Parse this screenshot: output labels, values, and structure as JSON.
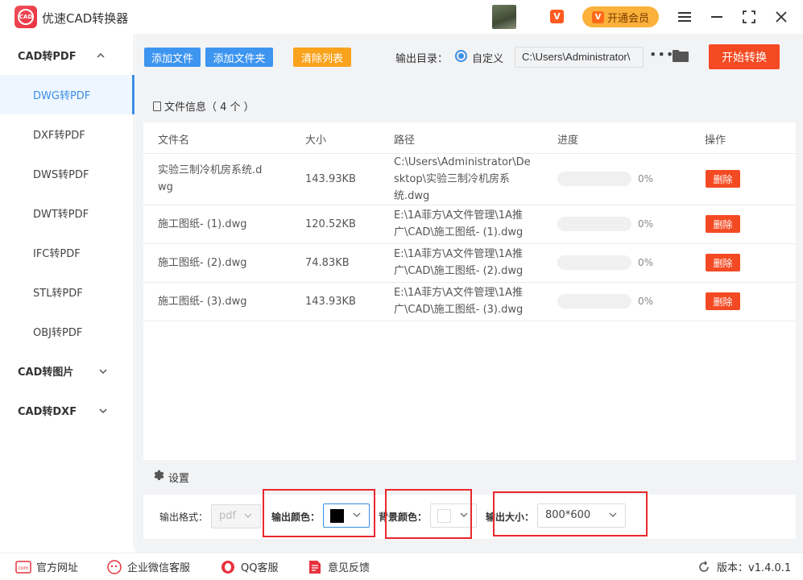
{
  "app": {
    "title": "优速CAD转换器",
    "logo_text": "CAD",
    "vip_badge": "V",
    "vip_button": "开通会员"
  },
  "sidebar": {
    "groups": [
      {
        "label": "CAD转PDF",
        "expanded": true
      },
      {
        "label": "CAD转图片",
        "expanded": false
      },
      {
        "label": "CAD转DXF",
        "expanded": false
      }
    ],
    "items": [
      "DWG转PDF",
      "DXF转PDF",
      "DWS转PDF",
      "DWT转PDF",
      "IFC转PDF",
      "STL转PDF",
      "OBJ转PDF"
    ],
    "active": "DWG转PDF"
  },
  "toolbar": {
    "add_file": "添加文件",
    "add_folder": "添加文件夹",
    "clear_list": "清除列表",
    "output_dir_label": "输出目录：",
    "custom_label": "自定义",
    "output_path": "C:\\Users\\Administrator\\",
    "start": "开始转换"
  },
  "file_info": {
    "title": "文件信息（ 4 个 ）",
    "columns": [
      "文件名",
      "大小",
      "路径",
      "进度",
      "操作"
    ],
    "rows": [
      {
        "name1": "实验三制冷机房系统.d",
        "name2": "wg",
        "size": "143.93KB",
        "path1": "C:\\Users\\Administrator\\De",
        "path2": "sktop\\实验三制冷机房系",
        "path3": "统.dwg",
        "progress": "0%",
        "action": "删除"
      },
      {
        "name1": "施工图纸- (1).dwg",
        "size": "120.52KB",
        "path1": "E:\\1A菲方\\A文件管理\\1A推",
        "path2": "广\\CAD\\施工图纸- (1).dwg",
        "progress": "0%",
        "action": "删除"
      },
      {
        "name1": "施工图纸- (2).dwg",
        "size": "74.83KB",
        "path1": "E:\\1A菲方\\A文件管理\\1A推",
        "path2": "广\\CAD\\施工图纸- (2).dwg",
        "progress": "0%",
        "action": "删除"
      },
      {
        "name1": "施工图纸- (3).dwg",
        "size": "143.93KB",
        "path1": "E:\\1A菲方\\A文件管理\\1A推",
        "path2": "广\\CAD\\施工图纸- (3).dwg",
        "progress": "0%",
        "action": "删除"
      }
    ]
  },
  "settings": {
    "title": "设置",
    "format_label": "输出格式：",
    "format_value": "pdf",
    "color_label": "输出颜色：",
    "color_value": "#000000",
    "bg_label": "背景颜色：",
    "bg_value": "#ffffff",
    "size_label": "输出大小：",
    "size_value": "800*600"
  },
  "footer": {
    "website": "官方网址",
    "wechat": "企业微信客服",
    "qq": "QQ客服",
    "feedback": "意见反馈",
    "version": "版本：v1.4.0.1"
  },
  "colors": {
    "accent": "#3e95f0",
    "danger": "#f44a23",
    "warning": "#f9a21c"
  }
}
